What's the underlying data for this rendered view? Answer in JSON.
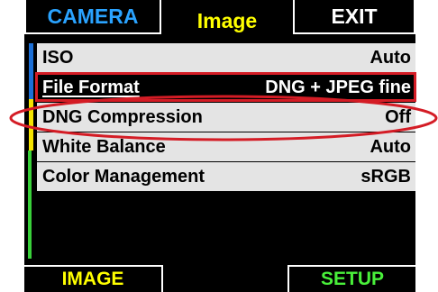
{
  "tabs": {
    "camera": "CAMERA",
    "image": "Image",
    "exit": "EXIT"
  },
  "menu": {
    "items": [
      {
        "label": "ISO",
        "value": "Auto"
      },
      {
        "label": "File Format",
        "value": "DNG + JPEG fine"
      },
      {
        "label": "DNG Compression",
        "value": "Off"
      },
      {
        "label": "White Balance",
        "value": "Auto"
      },
      {
        "label": "Color Management",
        "value": "sRGB"
      }
    ],
    "selected_index": 1
  },
  "softkeys": {
    "left": "IMAGE",
    "right": "SETUP"
  },
  "colors": {
    "tab_camera": "#2aa3ff",
    "tab_image": "#ffff00",
    "softkey_left": "#ffff00",
    "softkey_right": "#49f03a",
    "annotation": "#d41c25",
    "row_bg": "#e4e4e4",
    "scroll_blue": "#1c6fd6",
    "scroll_yellow": "#f5e400",
    "scroll_green": "#39d13a"
  }
}
